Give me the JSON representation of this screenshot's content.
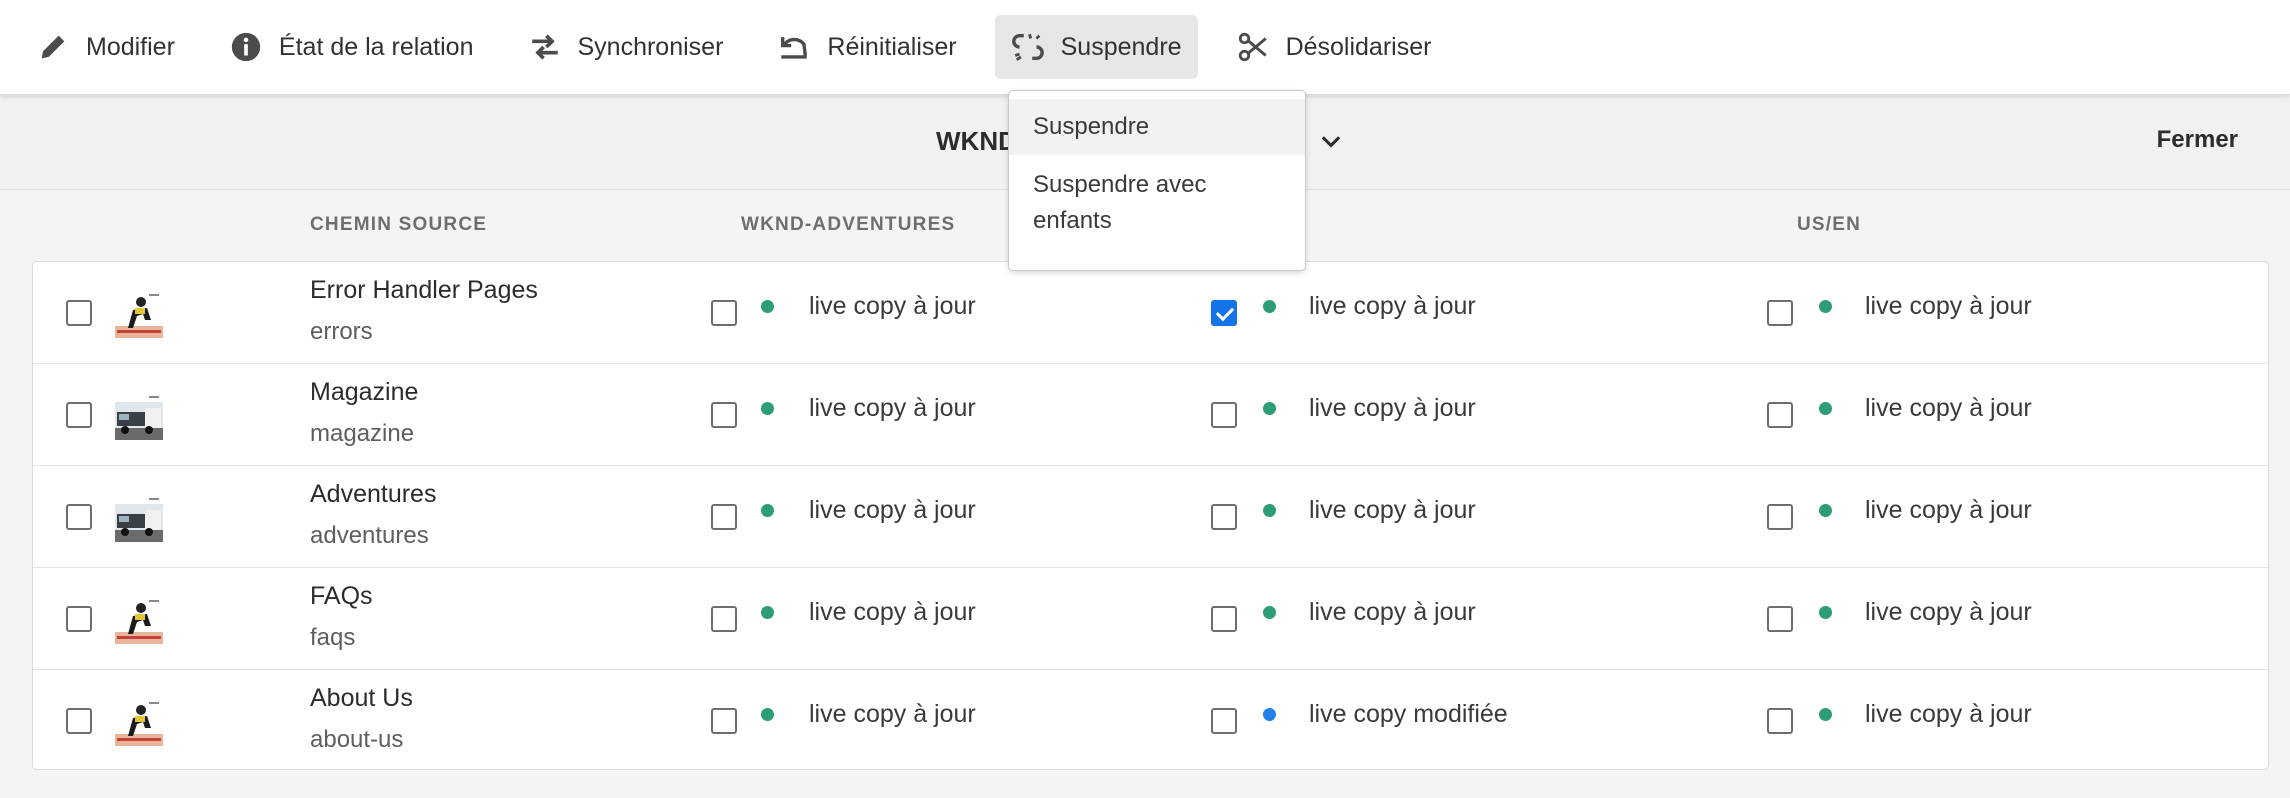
{
  "toolbar": {
    "items": [
      {
        "label": "Modifier",
        "icon": "pencil-icon"
      },
      {
        "label": "État de la relation",
        "icon": "info-icon"
      },
      {
        "label": "Synchroniser",
        "icon": "sync-icon"
      },
      {
        "label": "Réinitialiser",
        "icon": "undo-icon"
      },
      {
        "label": "Suspendre",
        "icon": "unlink-icon"
      },
      {
        "label": "Désolidariser",
        "icon": "scissors-icon"
      }
    ]
  },
  "panel": {
    "title": "WKND",
    "close_label": "Fermer"
  },
  "columns": {
    "source_path": "CHEMIN SOURCE",
    "col1": "WKND-ADVENTURES",
    "col3": "US/EN"
  },
  "dropdown": {
    "items": [
      "Suspendre",
      "Suspendre avec enfants"
    ]
  },
  "rows": [
    {
      "title": "Error Handler Pages",
      "path": "errors",
      "thumb": "runner",
      "c1": {
        "checked": false,
        "status": "live copy à jour",
        "color": "#2d9d78"
      },
      "c2": {
        "checked": true,
        "status": "live copy à jour",
        "color": "#2d9d78"
      },
      "c3": {
        "checked": false,
        "status": "live copy à jour",
        "color": "#2d9d78"
      }
    },
    {
      "title": "Magazine",
      "path": "magazine",
      "thumb": "van",
      "c1": {
        "checked": false,
        "status": "live copy à jour",
        "color": "#2d9d78"
      },
      "c2": {
        "checked": false,
        "status": "live copy à jour",
        "color": "#2d9d78"
      },
      "c3": {
        "checked": false,
        "status": "live copy à jour",
        "color": "#2d9d78"
      }
    },
    {
      "title": "Adventures",
      "path": "adventures",
      "thumb": "van",
      "c1": {
        "checked": false,
        "status": "live copy à jour",
        "color": "#2d9d78"
      },
      "c2": {
        "checked": false,
        "status": "live copy à jour",
        "color": "#2d9d78"
      },
      "c3": {
        "checked": false,
        "status": "live copy à jour",
        "color": "#2d9d78"
      }
    },
    {
      "title": "FAQs",
      "path": "faqs",
      "thumb": "runner",
      "c1": {
        "checked": false,
        "status": "live copy à jour",
        "color": "#2d9d78"
      },
      "c2": {
        "checked": false,
        "status": "live copy à jour",
        "color": "#2d9d78"
      },
      "c3": {
        "checked": false,
        "status": "live copy à jour",
        "color": "#2d9d78"
      }
    },
    {
      "title": "About Us",
      "path": "about-us",
      "thumb": "runner",
      "c1": {
        "checked": false,
        "status": "live copy à jour",
        "color": "#2d9d78"
      },
      "c2": {
        "checked": false,
        "status": "live copy modifiée",
        "color": "#2680eb"
      },
      "c3": {
        "checked": false,
        "status": "live copy à jour",
        "color": "#2d9d78"
      }
    }
  ]
}
